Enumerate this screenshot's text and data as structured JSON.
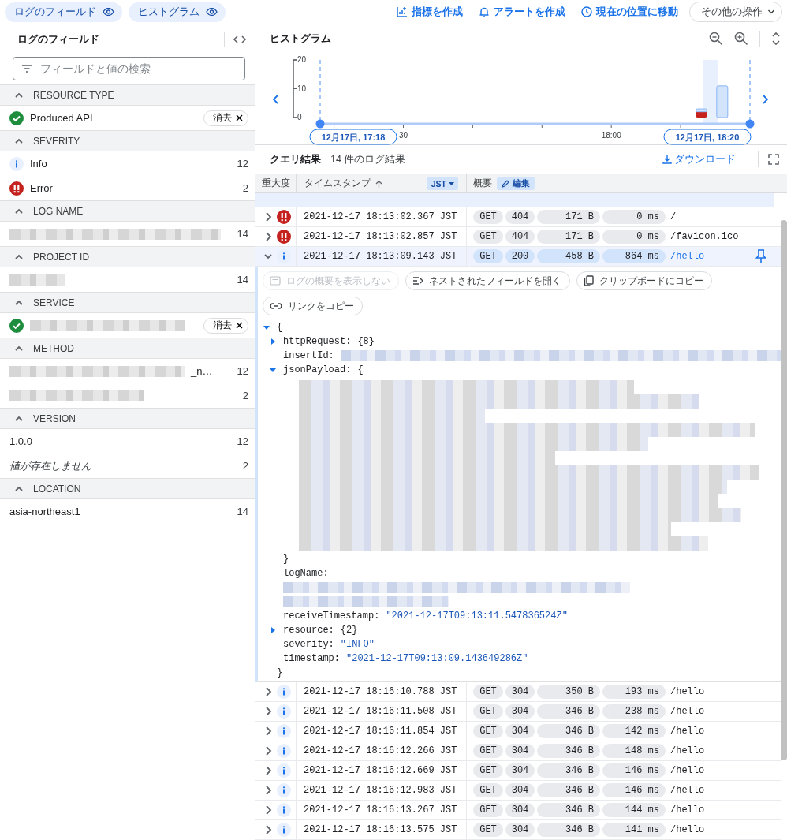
{
  "top_bar": {
    "toggles": [
      {
        "label": "ログのフィールド",
        "on": true
      },
      {
        "label": "ヒストグラム",
        "on": true
      }
    ],
    "actions": [
      {
        "label": "指標を作成",
        "kind": "metric"
      },
      {
        "label": "アラートを作成",
        "kind": "alert"
      },
      {
        "label": "現在の位置に移動",
        "kind": "clock"
      }
    ],
    "more_button": "その他の操作"
  },
  "fields_panel": {
    "title": "ログのフィールド",
    "search": {
      "placeholder": "フィールドと値の検索"
    },
    "sections": [
      {
        "name": "RESOURCE TYPE",
        "expanded": true,
        "items": [
          {
            "kind": "value",
            "selected": true,
            "label": "Produced API",
            "clear": "消去"
          }
        ]
      },
      {
        "name": "SEVERITY",
        "expanded": true,
        "items": [
          {
            "kind": "info",
            "selected": false,
            "label": "Info",
            "count": "12"
          },
          {
            "kind": "error",
            "selected": false,
            "label": "Error",
            "count": "2"
          }
        ]
      },
      {
        "name": "LOG NAME",
        "expanded": true,
        "items": [
          {
            "kind": "redacted",
            "selected": false,
            "count": "14"
          }
        ]
      },
      {
        "name": "PROJECT ID",
        "expanded": true,
        "items": [
          {
            "kind": "redacted",
            "selected": false,
            "count": "14"
          }
        ]
      },
      {
        "name": "SERVICE",
        "expanded": true,
        "items": [
          {
            "kind": "redacted",
            "selected": true,
            "clear": "消去"
          }
        ]
      },
      {
        "name": "METHOD",
        "expanded": true,
        "items": [
          {
            "kind": "redacted",
            "selected": false,
            "label": "_n…",
            "count": "12"
          },
          {
            "kind": "redacted",
            "selected": false,
            "count": "2"
          }
        ]
      },
      {
        "name": "VERSION",
        "expanded": true,
        "items": [
          {
            "kind": "value",
            "selected": false,
            "label": "1.0.0",
            "count": "12"
          },
          {
            "kind": "missing",
            "selected": false,
            "label": "値が存在しません",
            "count": "2"
          }
        ]
      },
      {
        "name": "LOCATION",
        "expanded": true,
        "items": [
          {
            "kind": "value",
            "selected": false,
            "label": "asia-northeast1",
            "count": "14"
          }
        ]
      }
    ]
  },
  "histogram": {
    "title": "ヒストグラム",
    "range_start": "12月17日, 17:18",
    "range_end": "12月17日, 18:20",
    "chart_data": {
      "type": "bar",
      "stacked": true,
      "ylim": [
        0,
        20
      ],
      "yticks": [
        0,
        10,
        20
      ],
      "categories": [
        null,
        null,
        null,
        null,
        null,
        null,
        null,
        null,
        null,
        null,
        null,
        null,
        "30",
        null,
        null,
        null,
        null,
        null,
        null,
        null,
        null,
        null,
        null,
        null,
        null,
        null,
        null,
        null,
        null,
        null,
        null,
        null,
        null,
        null,
        null,
        null,
        null,
        null,
        null,
        null,
        null,
        null,
        "18:00",
        null,
        null,
        null,
        null,
        null,
        null,
        null,
        null,
        null,
        null,
        null,
        null,
        null,
        null,
        null,
        null,
        null,
        null,
        null,
        null
      ],
      "series": [
        {
          "color": "#c5221f",
          "values": [
            null,
            null,
            null,
            null,
            null,
            null,
            null,
            null,
            null,
            null,
            null,
            null,
            null,
            null,
            null,
            null,
            null,
            null,
            null,
            null,
            null,
            null,
            null,
            null,
            null,
            null,
            null,
            null,
            null,
            null,
            null,
            null,
            null,
            null,
            null,
            null,
            null,
            null,
            null,
            null,
            null,
            null,
            null,
            null,
            null,
            null,
            null,
            null,
            null,
            null,
            null,
            null,
            null,
            null,
            null,
            2,
            null,
            null,
            null,
            null,
            null,
            null,
            null
          ]
        },
        {
          "color": "#d2e3fc",
          "values": [
            null,
            null,
            null,
            null,
            null,
            null,
            null,
            null,
            null,
            null,
            null,
            null,
            null,
            null,
            null,
            null,
            null,
            null,
            null,
            null,
            null,
            null,
            null,
            null,
            null,
            null,
            null,
            null,
            null,
            null,
            null,
            null,
            null,
            null,
            null,
            null,
            null,
            null,
            null,
            null,
            null,
            null,
            null,
            null,
            null,
            null,
            null,
            null,
            null,
            null,
            null,
            null,
            null,
            null,
            null,
            1,
            null,
            null,
            11,
            null,
            null,
            null,
            null
          ]
        }
      ]
    }
  },
  "query_results": {
    "title": "クエリ結果",
    "count": "14 件のログ結果",
    "download": "ダウンロード"
  },
  "table": {
    "columns": [
      "重大度",
      "タイムスタンプ",
      "概要"
    ],
    "timezone": "JST",
    "edit": "編集",
    "rows": [
      {
        "kind": "error",
        "expanded": false,
        "timestamp": "2021-12-17 18:13:02.367 JST",
        "method": "GET",
        "status": "404",
        "size": "171 B",
        "latency": "0 ms",
        "path": "/"
      },
      {
        "kind": "error",
        "expanded": false,
        "timestamp": "2021-12-17 18:13:02.857 JST",
        "method": "GET",
        "status": "404",
        "size": "171 B",
        "latency": "0 ms",
        "path": "/favicon.ico"
      },
      {
        "kind": "info",
        "expanded": true,
        "timestamp": "2021-12-17 18:13:09.143 JST",
        "method": "GET",
        "status": "200",
        "size": "458 B",
        "latency": "864 ms",
        "path": "/hello"
      },
      {
        "kind": "info",
        "expanded": false,
        "timestamp": "2021-12-17 18:16:10.788 JST",
        "method": "GET",
        "status": "304",
        "size": "350 B",
        "latency": "193 ms",
        "path": "/hello"
      },
      {
        "kind": "info",
        "expanded": false,
        "timestamp": "2021-12-17 18:16:11.508 JST",
        "method": "GET",
        "status": "304",
        "size": "346 B",
        "latency": "238 ms",
        "path": "/hello"
      },
      {
        "kind": "info",
        "expanded": false,
        "timestamp": "2021-12-17 18:16:11.854 JST",
        "method": "GET",
        "status": "304",
        "size": "346 B",
        "latency": "142 ms",
        "path": "/hello"
      },
      {
        "kind": "info",
        "expanded": false,
        "timestamp": "2021-12-17 18:16:12.266 JST",
        "method": "GET",
        "status": "304",
        "size": "346 B",
        "latency": "148 ms",
        "path": "/hello"
      },
      {
        "kind": "info",
        "expanded": false,
        "timestamp": "2021-12-17 18:16:12.669 JST",
        "method": "GET",
        "status": "304",
        "size": "346 B",
        "latency": "146 ms",
        "path": "/hello"
      },
      {
        "kind": "info",
        "expanded": false,
        "timestamp": "2021-12-17 18:16:12.983 JST",
        "method": "GET",
        "status": "304",
        "size": "346 B",
        "latency": "146 ms",
        "path": "/hello"
      },
      {
        "kind": "info",
        "expanded": false,
        "timestamp": "2021-12-17 18:16:13.267 JST",
        "method": "GET",
        "status": "304",
        "size": "346 B",
        "latency": "144 ms",
        "path": "/hello"
      },
      {
        "kind": "info",
        "expanded": false,
        "timestamp": "2021-12-17 18:16:13.575 JST",
        "method": "GET",
        "status": "304",
        "size": "346 B",
        "latency": "141 ms",
        "path": "/hello"
      }
    ],
    "detail": {
      "buttons": [
        {
          "label": "ログの概要を表示しない",
          "kind": "summary",
          "disabled": true
        },
        {
          "label": "ネストされたフィールドを開く",
          "kind": "expand",
          "disabled": false
        },
        {
          "label": "クリップボードにコピー",
          "kind": "copy",
          "disabled": false
        },
        {
          "label": "リンクをコピー",
          "kind": "link",
          "disabled": false
        }
      ],
      "open": "{",
      "close": "}",
      "expanded": true,
      "fields": [
        {
          "key": "httpRequest:",
          "kind": "object",
          "expanded": false,
          "value": "{8}"
        },
        {
          "key": "insertId:",
          "kind": "redacted"
        },
        {
          "key": "jsonPayload:",
          "kind": "object",
          "expanded": true,
          "value": "{",
          "close": "}"
        },
        {
          "key": "logName:",
          "kind": "redacted-block"
        },
        {
          "key": "receiveTimestamp:",
          "kind": "string",
          "value": "\"2021-12-17T09:13:11.547836524Z\""
        },
        {
          "key": "resource:",
          "kind": "object",
          "expanded": false,
          "value": "{2}"
        },
        {
          "key": "severity:",
          "kind": "string",
          "value": "\"INFO\""
        },
        {
          "key": "timestamp:",
          "kind": "string",
          "value": "\"2021-12-17T09:13:09.143649286Z\""
        }
      ]
    }
  }
}
